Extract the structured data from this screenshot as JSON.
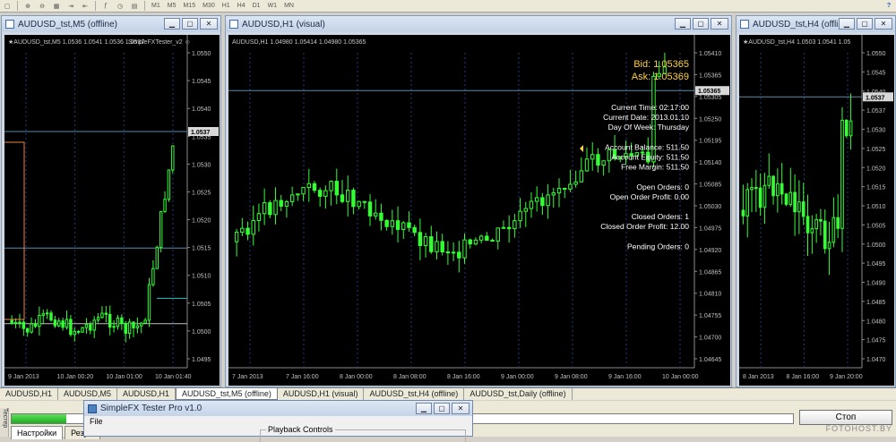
{
  "toolbar": {
    "timeframes": [
      "M1",
      "M5",
      "M15",
      "M30",
      "H1",
      "H4",
      "D1",
      "W1",
      "MN"
    ]
  },
  "windows": [
    {
      "title": "AUDUSD_tst,M5 (offline)",
      "info": "★AUDUSD_tst,M5  1.0536 1.0541 1.0536 1.0537",
      "overlay": "SimpleFXTester_v2 ☺",
      "price_axis": [
        "1.0550",
        "1.0545",
        "1.0540",
        "1.0535",
        "1.0530",
        "1.0525",
        "1.0520",
        "1.0515",
        "1.0510",
        "1.0505",
        "1.0500",
        "1.0495"
      ],
      "current_price": "1.0537",
      "time_axis": [
        "9 Jan 2013",
        "10 Jan 00:20",
        "10 Jan 01:00",
        "10 Jan 01:40"
      ]
    },
    {
      "title": "AUDUSD,H1 (visual)",
      "info": "AUDUSD,H1  1.04980 1.05414 1.04980 1.05365",
      "price_axis": [
        "1.05410",
        "1.05365",
        "1.05305",
        "1.05250",
        "1.05195",
        "1.05140",
        "1.05085",
        "1.05030",
        "1.04975",
        "1.04920",
        "1.04865",
        "1.04810",
        "1.04755",
        "1.04700",
        "1.04645"
      ],
      "current_price": "1.05365",
      "time_axis": [
        "7 Jan 2013",
        "7 Jan 16:00",
        "8 Jan 00:00",
        "8 Jan 08:00",
        "8 Jan 16:00",
        "9 Jan 00:00",
        "9 Jan 08:00",
        "9 Jan 16:00",
        "10 Jan 00:00"
      ],
      "bid": "Bid: 1.05365",
      "ask": "Ask: 1.05369",
      "stats": [
        "Current Time: 02:17:00",
        "Current Date: 2013.01.10",
        "Day Of Week: Thursday",
        "",
        "Account Balance: 511.50",
        "Account Equity: 511.50",
        "Free Margin: 511.50",
        "",
        "Open Orders: 0",
        "Open Order Profit: 0.00",
        "",
        "Closed Orders: 1",
        "Closed Order Profit: 12.00",
        "",
        "Pending Orders: 0"
      ]
    },
    {
      "title": "AUDUSD_tst,H4 (offli...",
      "info": "★AUDUSD_tst,H4  1.0503 1.0541 1.05",
      "price_axis": [
        "1.0550",
        "1.0545",
        "1.0540",
        "1.0537",
        "1.0530",
        "1.0525",
        "1.0520",
        "1.0515",
        "1.0510",
        "1.0505",
        "1.0500",
        "1.0495",
        "1.0490",
        "1.0485",
        "1.0480",
        "1.0475",
        "1.0470"
      ],
      "current_price": "1.0537",
      "time_axis": [
        "8 Jan 2013",
        "8 Jan 16:00",
        "9 Jan 20:00"
      ]
    }
  ],
  "tabs": [
    "AUDUSD,H1",
    "AUDUSD,M5",
    "AUDUSD,H1",
    "AUDUSD_tst,M5 (offline)",
    "AUDUSD,H1 (visual)",
    "AUDUSD_tst,H4 (offline)",
    "AUDUSD_tst,Daily (offline)"
  ],
  "active_tab_index": 3,
  "tester": {
    "side_label": "Тестер",
    "progress": 0.07,
    "stop_label": "Стоп",
    "tab_settings": "Настройки",
    "tab_results": "Резу..."
  },
  "dialog": {
    "title": "SimpleFX Tester Pro v1.0",
    "menu_file": "File",
    "group_label": "Playback Controls"
  },
  "watermark": "FOTOHOST.BY",
  "colors": {
    "bull": "#33ff33",
    "bear": "#33ff33",
    "grid": "#1e3c78",
    "axis_text": "#c0c0c0",
    "level_line": "#5d8aa8",
    "bid": "#ffd23a",
    "ask": "#ffd23a"
  }
}
